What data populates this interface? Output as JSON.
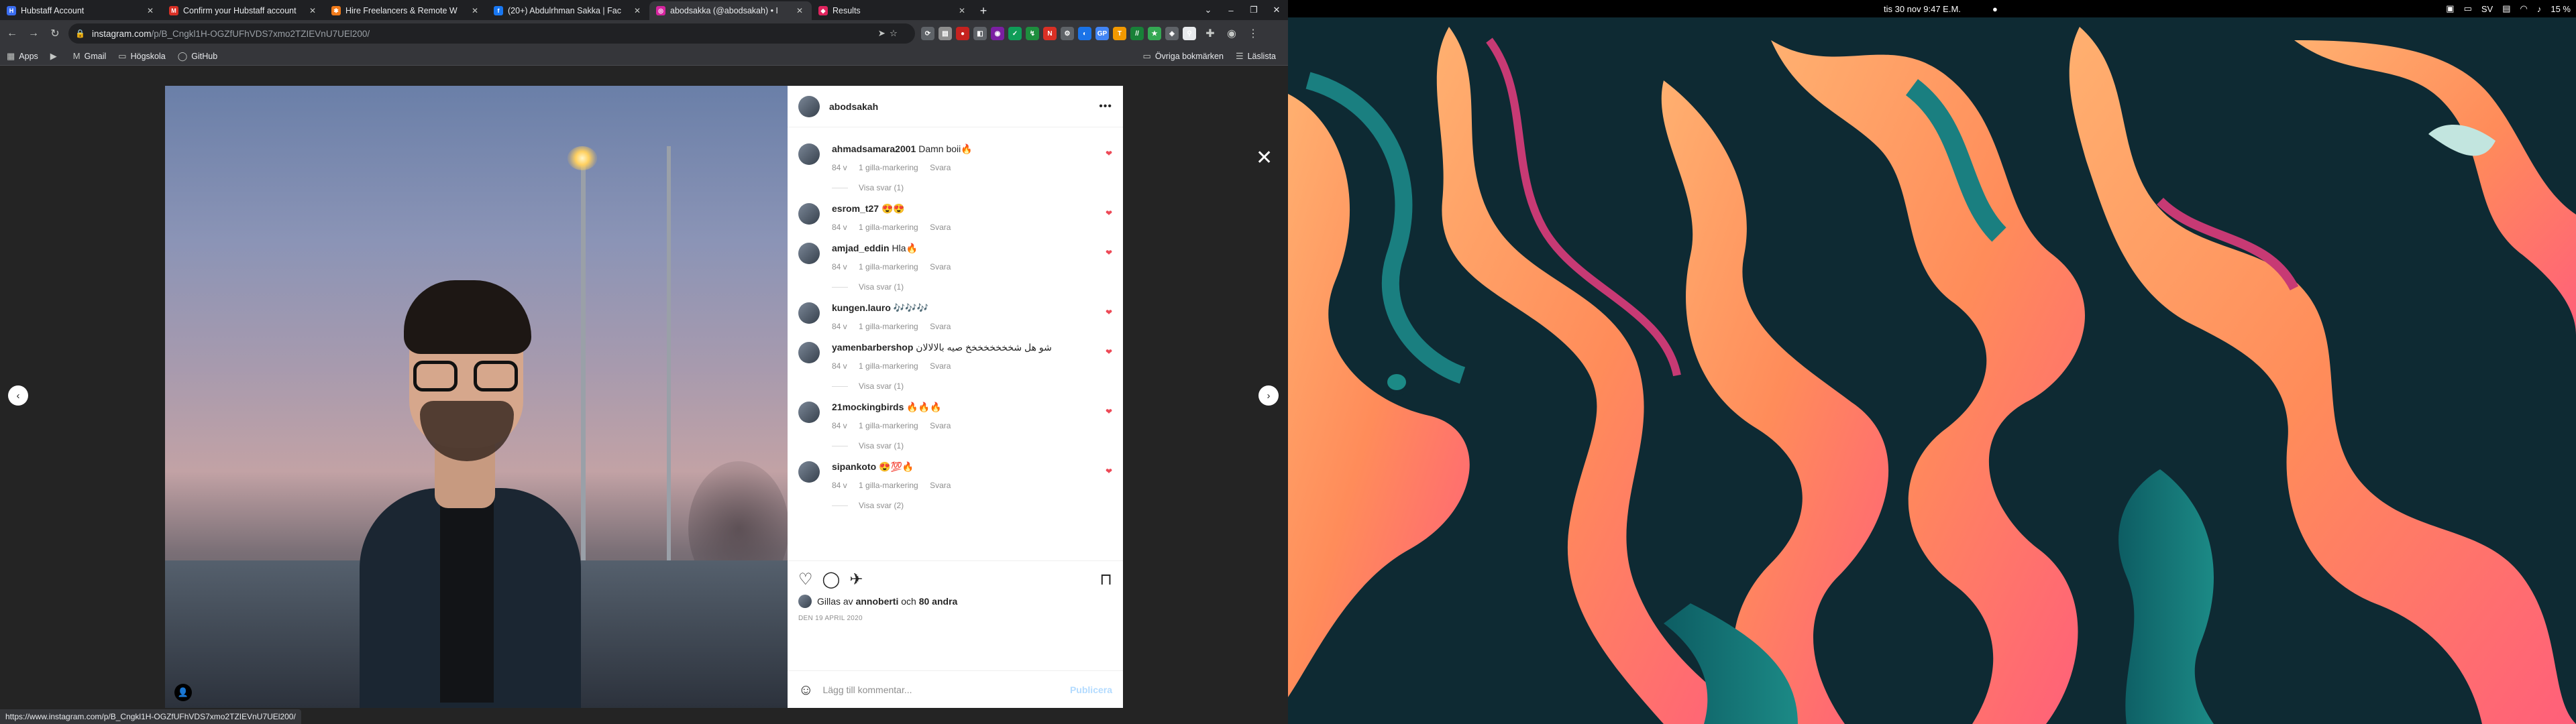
{
  "tabs": [
    {
      "title": "Hubstaff Account",
      "fav_color": "#3a6df0",
      "fav_char": "H"
    },
    {
      "title": "Confirm your Hubstaff account",
      "fav_color": "#d93025",
      "fav_char": "M"
    },
    {
      "title": "Hire Freelancers & Remote W",
      "fav_color": "#f07a19",
      "fav_char": "✱"
    },
    {
      "title": "(20+) Abdulrhman Sakka | Fac",
      "fav_color": "#1877f2",
      "fav_char": "f"
    },
    {
      "title": "abodsakka (@abodsakah) • I",
      "fav_color": "#d6249f",
      "fav_char": "◎"
    },
    {
      "title": "Results",
      "fav_color": "#e0245e",
      "fav_char": "◆"
    }
  ],
  "active_tab": 4,
  "new_tab": "+",
  "window_controls": [
    "⌄",
    "–",
    "❐",
    "✕"
  ],
  "omnibox": {
    "host": "instagram.com",
    "path": "/p/B_Cngkl1H-OGZfUFhVDS7xmo2TZIEVnU7UEl200/"
  },
  "extensions": [
    {
      "c": "#5f6368",
      "t": "⟳"
    },
    {
      "c": "#8e8e8e",
      "t": "▤"
    },
    {
      "c": "#c5221f",
      "t": "●"
    },
    {
      "c": "#5f6368",
      "t": "◧"
    },
    {
      "c": "#7b1fa2",
      "t": "◉"
    },
    {
      "c": "#0f9d58",
      "t": "✓"
    },
    {
      "c": "#1e8e3e",
      "t": "↯"
    },
    {
      "c": "#d93025",
      "t": "N"
    },
    {
      "c": "#5f6368",
      "t": "⚙"
    },
    {
      "c": "#1a73e8",
      "t": "◐"
    },
    {
      "c": "#4285f4",
      "t": "GP"
    },
    {
      "c": "#f29900",
      "t": "T"
    },
    {
      "c": "#188038",
      "t": "//"
    },
    {
      "c": "#34a853",
      "t": "★"
    },
    {
      "c": "#5f6368",
      "t": "◈"
    },
    {
      "c": "#e8eaed",
      "t": "⚲"
    }
  ],
  "bookmarks": [
    {
      "icon": "▦",
      "label": "Apps"
    },
    {
      "icon": "▶",
      "label": ""
    },
    {
      "icon": "M",
      "label": "Gmail"
    },
    {
      "icon": "▭",
      "label": "Högskola"
    },
    {
      "icon": "◯",
      "label": "GitHub"
    }
  ],
  "bookmarks_right": [
    {
      "icon": "▭",
      "label": "Övriga bokmärken"
    },
    {
      "icon": "☰",
      "label": "Läslista"
    }
  ],
  "post": {
    "owner": "abodsakah",
    "more": "•••",
    "comments": [
      {
        "user": "ahmadsamara2001",
        "text": "Damn boii🔥",
        "time": "84 v",
        "likes": "1 gilla-markering",
        "reply": "Svara",
        "replies": "Visa svar (1)"
      },
      {
        "user": "esrom_t27",
        "text": "😍😍",
        "time": "84 v",
        "likes": "1 gilla-markering",
        "reply": "Svara",
        "replies": ""
      },
      {
        "user": "amjad_eddin",
        "text": "Hla🔥",
        "time": "84 v",
        "likes": "1 gilla-markering",
        "reply": "Svara",
        "replies": "Visa svar (1)"
      },
      {
        "user": "kungen.lauro",
        "text": "🎶🎶🎶",
        "time": "84 v",
        "likes": "1 gilla-markering",
        "reply": "Svara",
        "replies": ""
      },
      {
        "user": "yamenbarbershop",
        "text": "شو هل شخخخخخخخخ صيه بالالالان",
        "time": "84 v",
        "likes": "1 gilla-markering",
        "reply": "Svara",
        "replies": "Visa svar (1)"
      },
      {
        "user": "21mockingbirds",
        "text": "🔥🔥🔥",
        "time": "84 v",
        "likes": "1 gilla-markering",
        "reply": "Svara",
        "replies": "Visa svar (1)"
      },
      {
        "user": "sipankoto",
        "text": "😍💯🔥",
        "time": "84 v",
        "likes": "1 gilla-markering",
        "reply": "Svara",
        "replies": "Visa svar (2)"
      }
    ],
    "likes_prefix": "Gillas av",
    "likes_user": "annoberti",
    "likes_mid": "och",
    "likes_others": "80 andra",
    "date": "DEN 19 APRIL 2020",
    "add_comment_placeholder": "Lägg till kommentar...",
    "post_button": "Publicera"
  },
  "status_url": "https://www.instagram.com/p/B_Cngkl1H-OGZfUFhVDS7xmo2TZIEVnU7UEl200/",
  "desktop": {
    "clock": "tis 30 nov   9:47 E.M.",
    "dot": "●",
    "keyboard": "SV",
    "battery": "15 %"
  }
}
